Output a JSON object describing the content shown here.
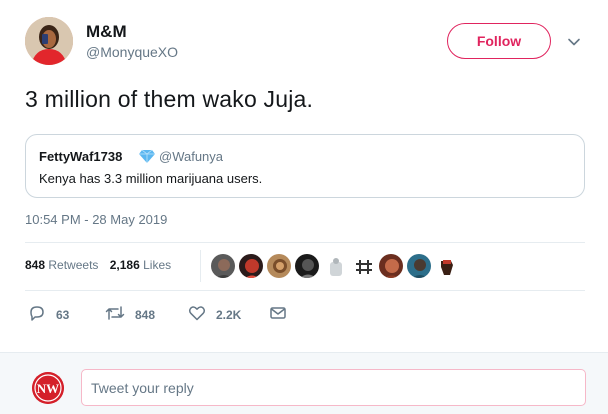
{
  "tweet": {
    "author": {
      "display_name": "M&M",
      "handle": "@MonyqueXO"
    },
    "follow_label": "Follow",
    "text": "3 million of them wako Juja.",
    "quoted": {
      "display_name": "FettyWaf1738",
      "handle": "@Wafunya",
      "text": "Kenya has 3.3 million marijuana users."
    },
    "timestamp": "10:54 PM - 28 May 2019",
    "stats": {
      "retweets_count": "848",
      "retweets_label": "Retweets",
      "likes_count": "2,186",
      "likes_label": "Likes"
    },
    "actions": {
      "replies": "63",
      "retweets": "848",
      "likes": "2.2K"
    }
  },
  "reply": {
    "placeholder": "Tweet your reply",
    "avatar_text": "NW"
  },
  "colors": {
    "accent_pink": "#e0245e",
    "muted_text": "#657786",
    "border": "#e6ecf0",
    "verified_blue": "#1da1f2"
  },
  "icons": [
    "chevron-down-icon",
    "verified-badge-icon",
    "reply-icon",
    "retweet-icon",
    "heart-icon",
    "message-icon"
  ]
}
